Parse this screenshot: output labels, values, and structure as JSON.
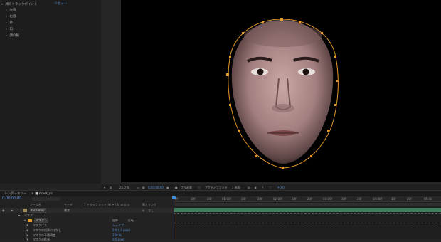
{
  "effects_panel": {
    "header": {
      "label": "顔のトラックポイント",
      "value": "リセット"
    },
    "items": [
      {
        "label": "左眉"
      },
      {
        "label": "右眉"
      },
      {
        "label": "鼻"
      },
      {
        "label": "口"
      },
      {
        "label": "顔の輪"
      }
    ]
  },
  "colors": {
    "accent": "#3d8fe0",
    "mask_path": "#e59a2a",
    "clip_bar": "#3f8a66"
  },
  "viewer_toolbar": {
    "zoom": "25.0 %",
    "timecode": "0;00;00;00",
    "resolution": "フル画質",
    "camera": "アクティブカメラ",
    "views": "1 画面",
    "offset": "+0.0"
  },
  "timeline": {
    "tabs": [
      "レンダーキュー",
      "mask_m"
    ],
    "current_time": "0;00;00;00",
    "search_placeholder": "",
    "column_headers": {
      "source_name": "ソース名",
      "mode": "モード",
      "trkmat": "T トラックマット",
      "switches": "単 ✶ \\ fx ⊞ ◎ ◎",
      "parent": "親とリンク"
    },
    "layer": {
      "number": "1",
      "name": "face.mov",
      "mode": "通常",
      "parent": "なし"
    },
    "rows": [
      {
        "label": "マスク"
      },
      {
        "label": "マスク 1",
        "mode": "加算",
        "inverted": "反転"
      },
      {
        "label": "マスクパス",
        "value": "シェイプ..."
      },
      {
        "label": "マスクの境界のぼかし",
        "value": "0.0,0.0 pixel"
      },
      {
        "label": "マスクの不透明度",
        "value": "100 %"
      },
      {
        "label": "マスクの拡張",
        "value": "0.0 pixel"
      }
    ],
    "ruler": [
      "0f",
      "10f",
      "20f",
      "01:00f",
      "10f",
      "20f",
      "02:00f",
      "10f",
      "20f",
      "03:00f",
      "10f",
      "20f",
      "04:00f",
      "10f",
      "20f",
      "05:00"
    ]
  }
}
